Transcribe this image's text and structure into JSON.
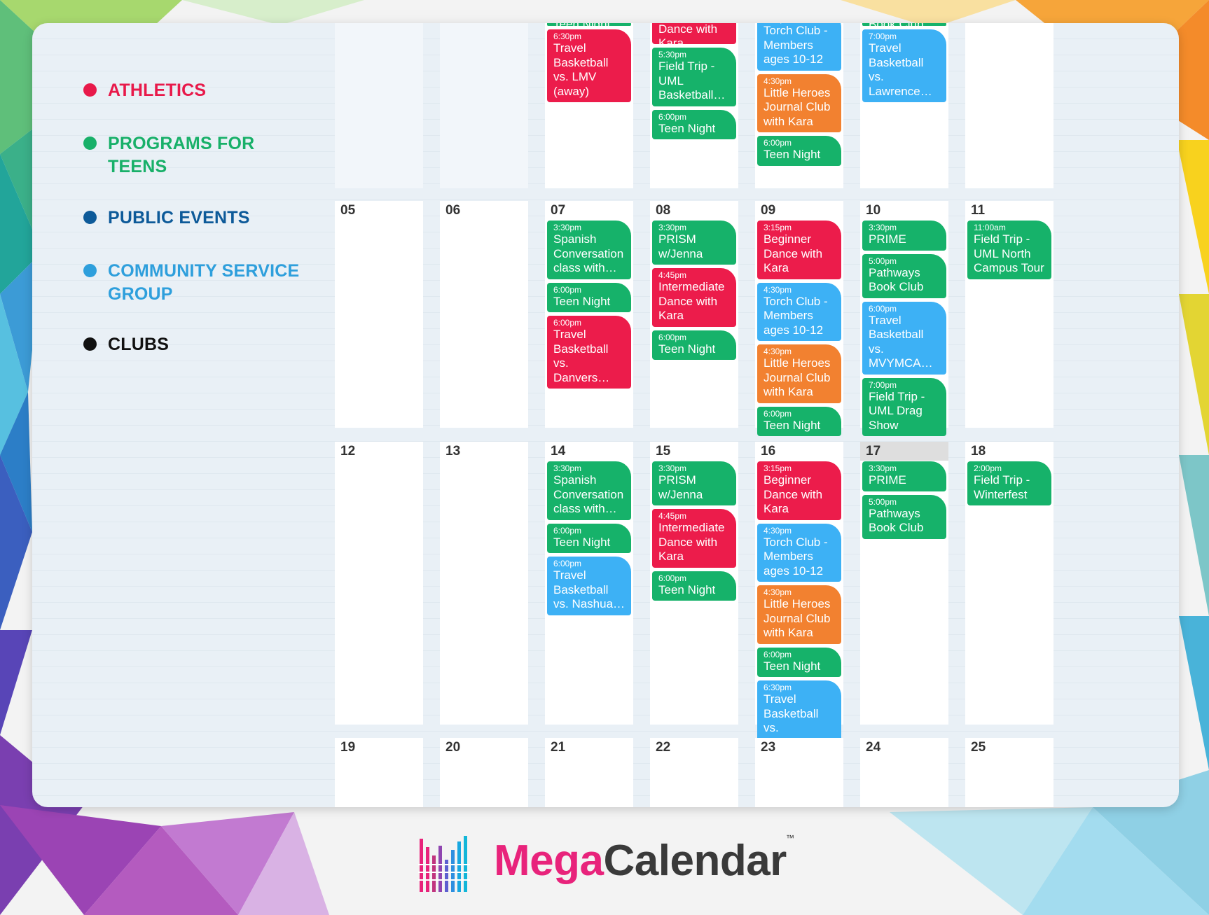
{
  "colors": {
    "athletics": "#e8194a",
    "programs_for_teens": "#18b069",
    "public_events": "#0d5a99",
    "community_service": "#2e9fdc",
    "clubs": "#111111",
    "event_red": "#ec1c4b",
    "event_green": "#16b26a",
    "event_blue": "#3db1f5",
    "event_orange": "#f28130"
  },
  "legend": [
    {
      "label": "ATHLETICS",
      "color": "#e8194a"
    },
    {
      "label": "PROGRAMS FOR TEENS",
      "color": "#18b069"
    },
    {
      "label": "PUBLIC EVENTS",
      "color": "#0d5a99"
    },
    {
      "label": "COMMUNITY SERVICE GROUP",
      "color": "#2e9fdc"
    },
    {
      "label": "CLUBS",
      "color": "#111111"
    }
  ],
  "weeks": [
    {
      "days": [
        {
          "num": "",
          "events": []
        },
        {
          "num": "",
          "events": []
        },
        {
          "num": "",
          "events": [
            {
              "time": "",
              "name": "Teen Night",
              "color": "green",
              "partial": true
            },
            {
              "time": "6:30pm",
              "name": "Travel Basketball vs. LMV (away)",
              "color": "red"
            }
          ]
        },
        {
          "num": "",
          "events": [
            {
              "time": "",
              "name": "Intermediate Dance with Kara",
              "color": "red",
              "partial": true
            },
            {
              "time": "5:30pm",
              "name": "Field Trip - UML Basketball…",
              "color": "green"
            },
            {
              "time": "6:00pm",
              "name": "Teen Night",
              "color": "green"
            }
          ]
        },
        {
          "num": "",
          "events": [
            {
              "time": "4:30pm",
              "name": "Torch Club - Members ages 10-12",
              "color": "blue"
            },
            {
              "time": "4:30pm",
              "name": "Little Heroes Journal Club with Kara",
              "color": "orange"
            },
            {
              "time": "6:00pm",
              "name": "Teen Night",
              "color": "green"
            }
          ]
        },
        {
          "num": "",
          "events": [
            {
              "time": "",
              "name": "Book Club",
              "color": "green",
              "partial": true
            },
            {
              "time": "7:00pm",
              "name": "Travel Basketball vs. Lawrence…",
              "color": "blue"
            }
          ]
        },
        {
          "num": "",
          "events": []
        }
      ]
    },
    {
      "days": [
        {
          "num": "05",
          "events": []
        },
        {
          "num": "06",
          "events": []
        },
        {
          "num": "07",
          "events": [
            {
              "time": "3:30pm",
              "name": "Spanish Conversation class with…",
              "color": "green"
            },
            {
              "time": "6:00pm",
              "name": "Teen Night",
              "color": "green"
            },
            {
              "time": "6:00pm",
              "name": "Travel Basketball vs. Danvers…",
              "color": "red"
            }
          ]
        },
        {
          "num": "08",
          "events": [
            {
              "time": "3:30pm",
              "name": "PRISM w/Jenna",
              "color": "green"
            },
            {
              "time": "4:45pm",
              "name": "Intermediate Dance with Kara",
              "color": "red"
            },
            {
              "time": "6:00pm",
              "name": "Teen Night",
              "color": "green"
            }
          ]
        },
        {
          "num": "09",
          "events": [
            {
              "time": "3:15pm",
              "name": "Beginner Dance with Kara",
              "color": "red"
            },
            {
              "time": "4:30pm",
              "name": "Torch Club - Members ages 10-12",
              "color": "blue"
            },
            {
              "time": "4:30pm",
              "name": "Little Heroes Journal Club with Kara",
              "color": "orange"
            },
            {
              "time": "6:00pm",
              "name": "Teen Night",
              "color": "green"
            }
          ]
        },
        {
          "num": "10",
          "events": [
            {
              "time": "3:30pm",
              "name": "PRIME",
              "color": "green"
            },
            {
              "time": "5:00pm",
              "name": "Pathways Book Club",
              "color": "green"
            },
            {
              "time": "6:00pm",
              "name": "Travel Basketball vs. MVYMCA…",
              "color": "blue"
            },
            {
              "time": "7:00pm",
              "name": "Field Trip - UML Drag Show",
              "color": "green"
            }
          ]
        },
        {
          "num": "11",
          "events": [
            {
              "time": "11:00am",
              "name": "Field Trip - UML North Campus Tour",
              "color": "green"
            }
          ]
        }
      ]
    },
    {
      "days": [
        {
          "num": "12",
          "events": []
        },
        {
          "num": "13",
          "events": []
        },
        {
          "num": "14",
          "events": [
            {
              "time": "3:30pm",
              "name": "Spanish Conversation class with…",
              "color": "green"
            },
            {
              "time": "6:00pm",
              "name": "Teen Night",
              "color": "green"
            },
            {
              "time": "6:00pm",
              "name": "Travel Basketball vs. Nashua…",
              "color": "blue"
            }
          ]
        },
        {
          "num": "15",
          "events": [
            {
              "time": "3:30pm",
              "name": "PRISM w/Jenna",
              "color": "green"
            },
            {
              "time": "4:45pm",
              "name": "Intermediate Dance with Kara",
              "color": "red"
            },
            {
              "time": "6:00pm",
              "name": "Teen Night",
              "color": "green"
            }
          ]
        },
        {
          "num": "16",
          "events": [
            {
              "time": "3:15pm",
              "name": "Beginner Dance with Kara",
              "color": "red"
            },
            {
              "time": "4:30pm",
              "name": "Torch Club - Members ages 10-12",
              "color": "blue"
            },
            {
              "time": "4:30pm",
              "name": "Little Heroes Journal Club with Kara",
              "color": "orange"
            },
            {
              "time": "6:00pm",
              "name": "Teen Night",
              "color": "green"
            },
            {
              "time": "6:30pm",
              "name": "Travel Basketball vs. Waltham…",
              "color": "blue"
            }
          ]
        },
        {
          "num": "17",
          "today": true,
          "events": [
            {
              "time": "3:30pm",
              "name": "PRIME",
              "color": "green"
            },
            {
              "time": "5:00pm",
              "name": "Pathways Book Club",
              "color": "green"
            }
          ]
        },
        {
          "num": "18",
          "events": [
            {
              "time": "2:00pm",
              "name": "Field Trip - Winterfest",
              "color": "green"
            }
          ]
        }
      ]
    },
    {
      "days": [
        {
          "num": "19",
          "events": []
        },
        {
          "num": "20",
          "events": []
        },
        {
          "num": "21",
          "events": []
        },
        {
          "num": "22",
          "events": []
        },
        {
          "num": "23",
          "events": []
        },
        {
          "num": "24",
          "events": []
        },
        {
          "num": "25",
          "events": []
        }
      ]
    }
  ],
  "brand": {
    "mega": "Mega",
    "calendar": "Calendar",
    "tm": "™"
  }
}
